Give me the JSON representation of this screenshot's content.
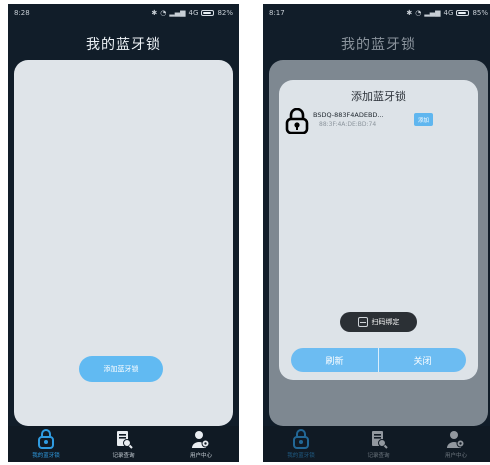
{
  "left_screen": {
    "status": {
      "time": "8:28",
      "network": "4G",
      "battery": "82%",
      "battery_level": 0.82
    },
    "title": "我的蓝牙锁",
    "add_button_label": "添加蓝牙锁",
    "tabs": [
      {
        "label": "我的蓝牙锁",
        "icon": "lock-icon",
        "active": true
      },
      {
        "label": "记录查询",
        "icon": "record-query-icon",
        "active": false
      },
      {
        "label": "用户中心",
        "icon": "user-center-icon",
        "active": false
      }
    ]
  },
  "right_screen": {
    "status": {
      "time": "8:17",
      "network": "4G",
      "battery": "85%",
      "battery_level": 0.85
    },
    "title": "我的蓝牙锁",
    "dialog": {
      "title": "添加蓝牙锁",
      "device": {
        "name": "BSDQ-883F4ADEBD...",
        "mac": "88:3F:4A:DE:BD:74",
        "button_label": "添加"
      },
      "scan_label": "扫码绑定",
      "refresh_label": "刷新",
      "close_label": "关闭"
    },
    "tabs": [
      {
        "label": "我的蓝牙锁",
        "icon": "lock-icon",
        "active": true
      },
      {
        "label": "记录查询",
        "icon": "record-query-icon",
        "active": false
      },
      {
        "label": "用户中心",
        "icon": "user-center-icon",
        "active": false
      }
    ]
  },
  "colors": {
    "accent": "#61baf2",
    "tab_active": "#2f9be0",
    "header_bg": "#111d29",
    "card_bg": "#dfe4e9"
  }
}
